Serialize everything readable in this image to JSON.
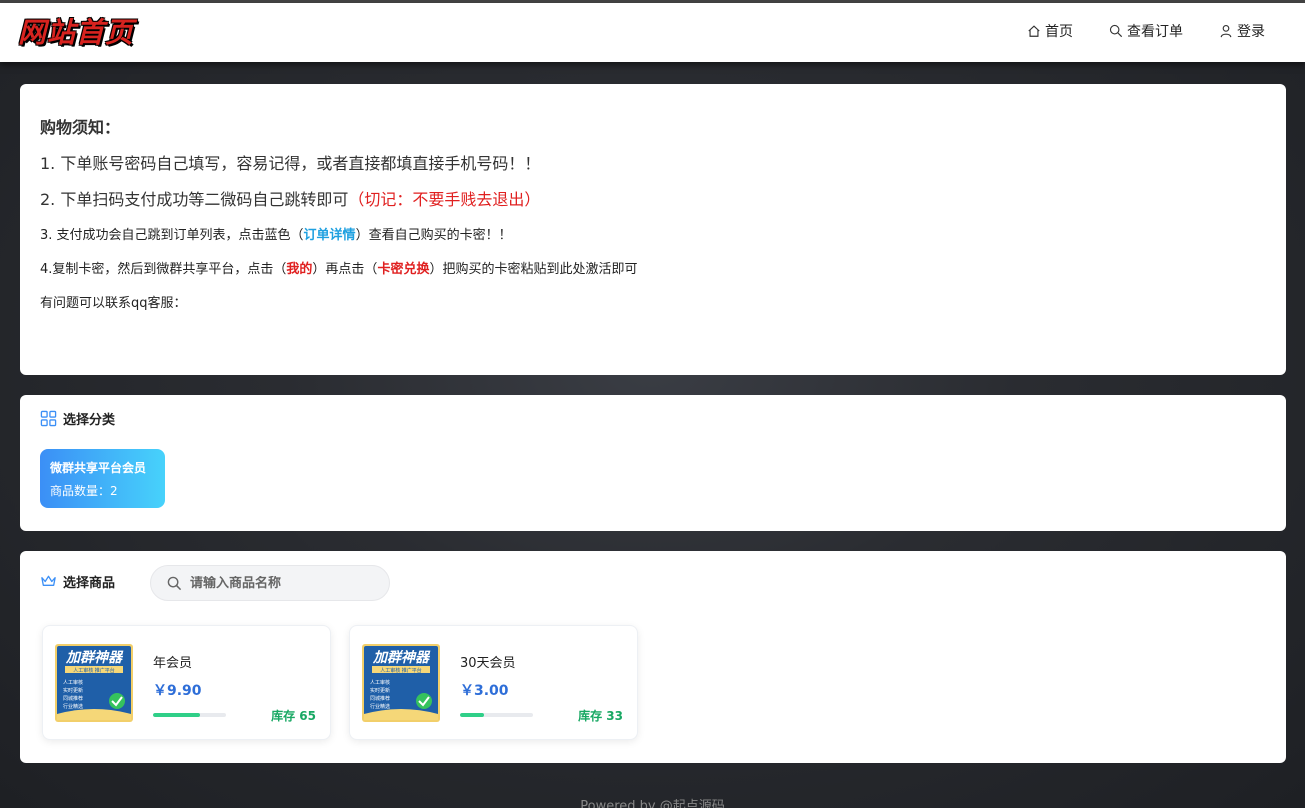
{
  "header": {
    "logo_text": "网站首页",
    "nav": [
      {
        "label": "首页",
        "icon": "home-icon"
      },
      {
        "label": "查看订单",
        "icon": "search-icon"
      },
      {
        "label": "登录",
        "icon": "user-icon"
      }
    ]
  },
  "notice": {
    "title": "购物须知：",
    "line1": "1. 下单账号密码自己填写，容易记得，或者直接都填直接手机号码！！",
    "line2_prefix": "2. 下单扫码支付成功等二微码自己跳转即可",
    "line2_red": "（切记：不要手贱去退出）",
    "line3_a": "3. 支付成功会自己跳到订单列表，点击蓝色（",
    "line3_link": "订单详情",
    "line3_b": "）查看自己购买的卡密！！",
    "line4_a": "4.复制卡密，然后到微群共享平台，点击（",
    "line4_mine": "我的",
    "line4_b": "）再点击（",
    "line4_redeem": "卡密兑换",
    "line4_c": "）把购买的卡密粘贴到此处激活即可",
    "line5": "有问题可以联系qq客服："
  },
  "category_section": {
    "title": "选择分类",
    "categories": [
      {
        "name": "微群共享平台会员",
        "count_text": "商品数量：2"
      }
    ]
  },
  "product_section": {
    "title": "选择商品",
    "search_placeholder": "请输入商品名称",
    "products": [
      {
        "name": "年会员",
        "price": "￥9.90",
        "stock_text": "库存 65",
        "stock_fraction": 0.65,
        "image_title": "加群神器",
        "image_sub": "人工审核 推广平台",
        "image_lines": [
          "人工审核",
          "实时更新",
          "同城推荐",
          "行业精选"
        ]
      },
      {
        "name": "30天会员",
        "price": "￥3.00",
        "stock_text": "库存 33",
        "stock_fraction": 0.33,
        "image_title": "加群神器",
        "image_sub": "人工审核 推广平台",
        "image_lines": [
          "人工审核",
          "实时更新",
          "同城推荐",
          "行业精选"
        ]
      }
    ]
  },
  "footer": {
    "text": "Powered by @起点源码"
  },
  "colors": {
    "accent_blue": "#2e6ed8",
    "stock_green": "#18a863",
    "warn_red": "#e02020",
    "link_blue": "#1ea0e0"
  }
}
